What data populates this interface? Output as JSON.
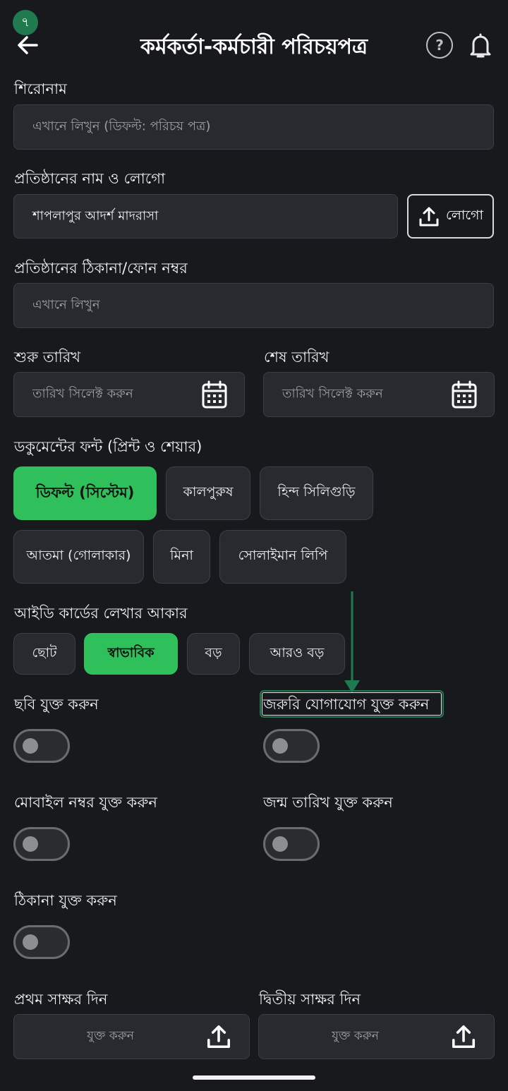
{
  "status_badge": "৭",
  "header": {
    "title": "কর্মকর্তা-কর্মচারী পরিচয়পত্র",
    "help_symbol": "?"
  },
  "title_field": {
    "label": "শিরোনাম",
    "placeholder": "এখানে লিখুন (ডিফল্ট: পরিচয় পত্র)"
  },
  "institution": {
    "label": "প্রতিষ্ঠানের নাম ও লোগো",
    "value": "শাপলাপুর আদর্শ মাদরাসা",
    "logo_button": "লোগো"
  },
  "address": {
    "label": "প্রতিষ্ঠানের ঠিকানা/ফোন নম্বর",
    "placeholder": "এখানে লিখুন"
  },
  "dates": {
    "start_label": "শুরু তারিখ",
    "start_placeholder": "তারিখ সিলেক্ট করুন",
    "end_label": "শেষ তারিখ",
    "end_placeholder": "তারিখ সিলেক্ট করুন"
  },
  "font_section": {
    "label": "ডকুমেন্টের ফন্ট (প্রিন্ট ও শেয়ার)",
    "options": [
      "ডিফল্ট (সিস্টেম)",
      "কালপুরুষ",
      "হিন্দ সিলিগুড়ি",
      "আতমা (গোলাকার)",
      "মিনা",
      "সোলাইমান লিপি"
    ],
    "selected": "ডিফল্ট (সিস্টেম)"
  },
  "size_section": {
    "label": "আইডি কার্ডের লেখার আকার",
    "options": [
      "ছোট",
      "স্বাভাবিক",
      "বড়",
      "আরও বড়"
    ],
    "selected": "স্বাভাবিক"
  },
  "toggles": {
    "photo": {
      "label": "ছবি যুক্ত করুন",
      "on": false
    },
    "emergency": {
      "label": "জরুরি যোগাযোগ যুক্ত করুন",
      "on": false
    },
    "mobile": {
      "label": "মোবাইল নম্বর যুক্ত করুন",
      "on": false
    },
    "birth": {
      "label": "জন্ম তারিখ যুক্ত করুন",
      "on": false
    },
    "address": {
      "label": "ঠিকানা যুক্ত করুন",
      "on": false
    }
  },
  "signatures": {
    "first_label": "প্রথম সাক্ষর দিন",
    "first_placeholder": "যুক্ত করুন",
    "second_label": "দ্বিতীয় সাক্ষর দিন",
    "second_placeholder": "যুক্ত করুন"
  },
  "colors": {
    "accent": "#2fc05c",
    "badge": "#1f7a4f",
    "background": "#17191c",
    "field": "#272a2f"
  },
  "icons": [
    "back-arrow-icon",
    "help-icon",
    "bell-icon",
    "upload-icon",
    "calendar-icon"
  ]
}
